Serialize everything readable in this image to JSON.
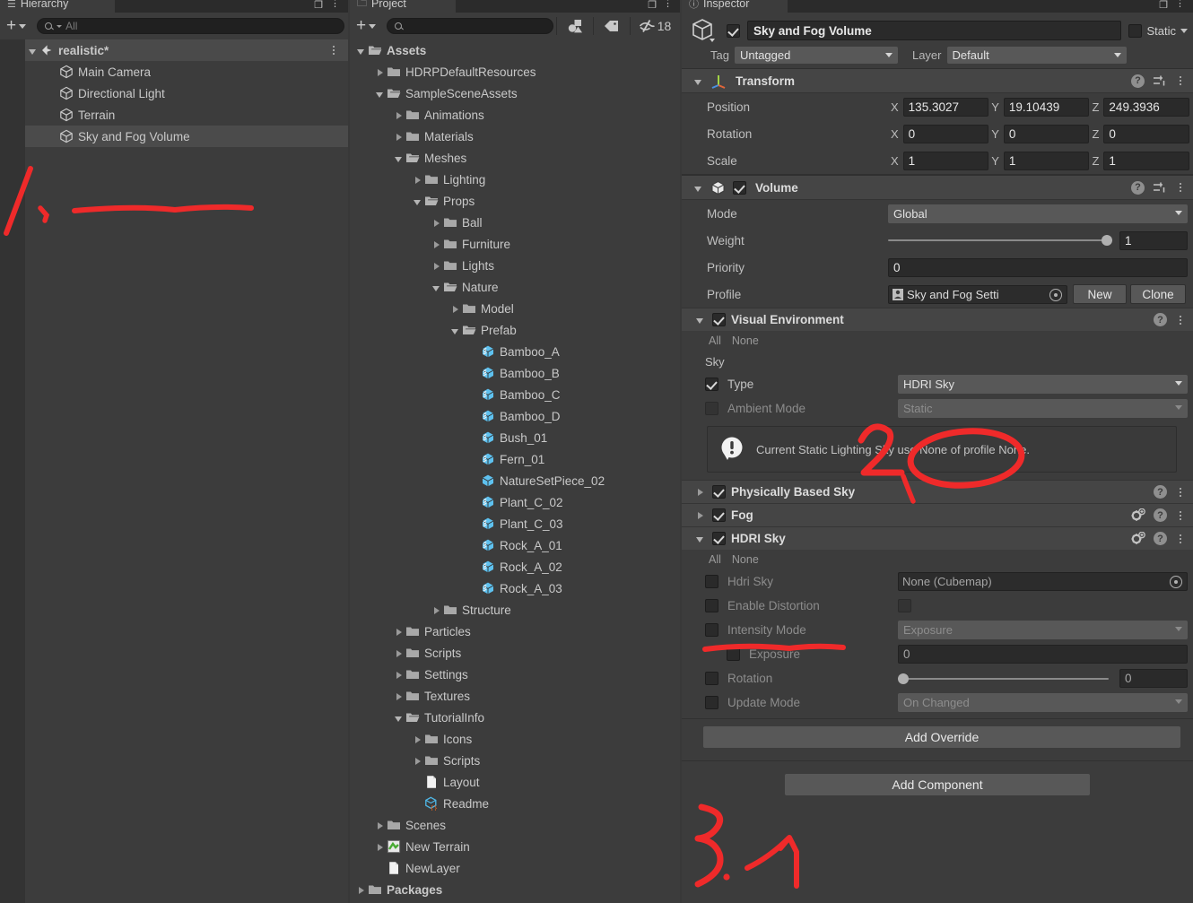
{
  "window": {
    "hierarchy_tab": "Hierarchy",
    "project_tab": "Project",
    "inspector_tab": "Inspector"
  },
  "hierarchy": {
    "search_placeholder": "All",
    "create_label": "+",
    "items": [
      {
        "label": "realistic*",
        "icon": "unity-scene-icon",
        "depth": 0,
        "expanded": true,
        "selected": false,
        "bold": true
      },
      {
        "label": "Main Camera",
        "icon": "gameobject-cube-icon",
        "depth": 1,
        "selected": false
      },
      {
        "label": "Directional Light",
        "icon": "gameobject-cube-icon",
        "depth": 1,
        "selected": false
      },
      {
        "label": "Terrain",
        "icon": "gameobject-cube-icon",
        "depth": 1,
        "selected": false
      },
      {
        "label": "Sky and Fog Volume",
        "icon": "gameobject-cube-icon",
        "depth": 1,
        "selected": true
      }
    ]
  },
  "project": {
    "search_placeholder": "",
    "create_label": "+",
    "hidden_count": "18",
    "items": [
      {
        "label": "Assets",
        "icon": "folder-open-icon",
        "depth": 0,
        "arrow": "down",
        "bold": true
      },
      {
        "label": "HDRPDefaultResources",
        "icon": "folder-icon",
        "depth": 1,
        "arrow": "right"
      },
      {
        "label": "SampleSceneAssets",
        "icon": "folder-open-icon",
        "depth": 1,
        "arrow": "down"
      },
      {
        "label": "Animations",
        "icon": "folder-icon",
        "depth": 2,
        "arrow": "right"
      },
      {
        "label": "Materials",
        "icon": "folder-icon",
        "depth": 2,
        "arrow": "right"
      },
      {
        "label": "Meshes",
        "icon": "folder-open-icon",
        "depth": 2,
        "arrow": "down"
      },
      {
        "label": "Lighting",
        "icon": "folder-icon",
        "depth": 3,
        "arrow": "right"
      },
      {
        "label": "Props",
        "icon": "folder-open-icon",
        "depth": 3,
        "arrow": "down"
      },
      {
        "label": "Ball",
        "icon": "folder-icon",
        "depth": 4,
        "arrow": "right"
      },
      {
        "label": "Furniture",
        "icon": "folder-icon",
        "depth": 4,
        "arrow": "right"
      },
      {
        "label": "Lights",
        "icon": "folder-icon",
        "depth": 4,
        "arrow": "right"
      },
      {
        "label": "Nature",
        "icon": "folder-open-icon",
        "depth": 4,
        "arrow": "down"
      },
      {
        "label": "Model",
        "icon": "folder-icon",
        "depth": 5,
        "arrow": "right"
      },
      {
        "label": "Prefab",
        "icon": "folder-open-icon",
        "depth": 5,
        "arrow": "down"
      },
      {
        "label": "Bamboo_A",
        "icon": "prefab-variant-icon",
        "depth": 6,
        "arrow": "none"
      },
      {
        "label": "Bamboo_B",
        "icon": "prefab-variant-icon",
        "depth": 6,
        "arrow": "none"
      },
      {
        "label": "Bamboo_C",
        "icon": "prefab-variant-icon",
        "depth": 6,
        "arrow": "none"
      },
      {
        "label": "Bamboo_D",
        "icon": "prefab-variant-icon",
        "depth": 6,
        "arrow": "none"
      },
      {
        "label": "Bush_01",
        "icon": "prefab-variant-icon",
        "depth": 6,
        "arrow": "none"
      },
      {
        "label": "Fern_01",
        "icon": "prefab-variant-icon",
        "depth": 6,
        "arrow": "none"
      },
      {
        "label": "NatureSetPiece_02",
        "icon": "prefab-icon",
        "depth": 6,
        "arrow": "none"
      },
      {
        "label": "Plant_C_02",
        "icon": "prefab-variant-icon",
        "depth": 6,
        "arrow": "none"
      },
      {
        "label": "Plant_C_03",
        "icon": "prefab-variant-icon",
        "depth": 6,
        "arrow": "none"
      },
      {
        "label": "Rock_A_01",
        "icon": "prefab-variant-icon",
        "depth": 6,
        "arrow": "none"
      },
      {
        "label": "Rock_A_02",
        "icon": "prefab-variant-icon",
        "depth": 6,
        "arrow": "none"
      },
      {
        "label": "Rock_A_03",
        "icon": "prefab-variant-icon",
        "depth": 6,
        "arrow": "none"
      },
      {
        "label": "Structure",
        "icon": "folder-icon",
        "depth": 4,
        "arrow": "right"
      },
      {
        "label": "Particles",
        "icon": "folder-icon",
        "depth": 2,
        "arrow": "right"
      },
      {
        "label": "Scripts",
        "icon": "folder-icon",
        "depth": 2,
        "arrow": "right"
      },
      {
        "label": "Settings",
        "icon": "folder-icon",
        "depth": 2,
        "arrow": "right"
      },
      {
        "label": "Textures",
        "icon": "folder-icon",
        "depth": 2,
        "arrow": "right"
      },
      {
        "label": "TutorialInfo",
        "icon": "folder-open-icon",
        "depth": 2,
        "arrow": "down"
      },
      {
        "label": "Icons",
        "icon": "folder-icon",
        "depth": 3,
        "arrow": "right"
      },
      {
        "label": "Scripts",
        "icon": "folder-icon",
        "depth": 3,
        "arrow": "right"
      },
      {
        "label": "Layout",
        "icon": "document-icon",
        "depth": 3,
        "arrow": "none"
      },
      {
        "label": "Readme",
        "icon": "script-asset-icon",
        "depth": 3,
        "arrow": "none"
      },
      {
        "label": "Scenes",
        "icon": "folder-icon",
        "depth": 1,
        "arrow": "right"
      },
      {
        "label": "New Terrain",
        "icon": "terrain-asset-icon",
        "depth": 1,
        "arrow": "right"
      },
      {
        "label": "NewLayer",
        "icon": "document-icon",
        "depth": 1,
        "arrow": "none"
      },
      {
        "label": "Packages",
        "icon": "folder-icon",
        "depth": 0,
        "arrow": "right",
        "bold": true
      }
    ]
  },
  "inspector": {
    "object": {
      "name": "Sky and Fog Volume",
      "enabled": true,
      "static_label": "Static",
      "tag_label": "Tag",
      "tag_value": "Untagged",
      "layer_label": "Layer",
      "layer_value": "Default"
    },
    "transform": {
      "title": "Transform",
      "rows": [
        {
          "label": "Position",
          "x": "135.3027",
          "y": "19.10439",
          "z": "249.3936"
        },
        {
          "label": "Rotation",
          "x": "0",
          "y": "0",
          "z": "0"
        },
        {
          "label": "Scale",
          "x": "1",
          "y": "1",
          "z": "1"
        }
      ],
      "axis_x": "X",
      "axis_y": "Y",
      "axis_z": "Z"
    },
    "volume": {
      "title": "Volume",
      "enabled": true,
      "mode_label": "Mode",
      "mode_value": "Global",
      "weight_label": "Weight",
      "weight_value": "1",
      "weight_percent": 100,
      "priority_label": "Priority",
      "priority_value": "0",
      "profile_label": "Profile",
      "profile_value": "Sky and Fog Setti",
      "new_label": "New",
      "clone_label": "Clone"
    },
    "visual_environment": {
      "title": "Visual Environment",
      "enabled": true,
      "expanded": true,
      "all_label": "All",
      "none_label": "None",
      "group_label": "Sky",
      "rows": [
        {
          "label": "Type",
          "value": "HDRI Sky",
          "checked": true,
          "disabled": false
        },
        {
          "label": "Ambient Mode",
          "value": "Static",
          "checked": false,
          "disabled": true
        }
      ],
      "info_message": "Current Static Lighting Sky use None of profile None."
    },
    "overrides": [
      {
        "title": "Physically Based Sky",
        "enabled": true,
        "expanded": false,
        "has_gear": false
      },
      {
        "title": "Fog",
        "enabled": true,
        "expanded": false,
        "has_gear": true
      }
    ],
    "hdri_sky": {
      "title": "HDRI Sky",
      "enabled": true,
      "expanded": true,
      "has_gear": true,
      "all_label": "All",
      "none_label": "None",
      "rows": [
        {
          "label": "Hdri Sky",
          "value": "None (Cubemap)",
          "kind": "object",
          "checked": false
        },
        {
          "label": "Enable Distortion",
          "value": "",
          "kind": "checkbox",
          "checked": false
        },
        {
          "label": "Intensity Mode",
          "value": "Exposure",
          "kind": "dropdown",
          "checked": false
        },
        {
          "label": "Exposure",
          "value": "0",
          "kind": "number",
          "checked": false,
          "indent": true
        },
        {
          "label": "Rotation",
          "value": "0",
          "kind": "slider",
          "checked": false,
          "percent": 0
        },
        {
          "label": "Update Mode",
          "value": "On Changed",
          "kind": "dropdown",
          "checked": false
        }
      ]
    },
    "add_override_label": "Add Override",
    "add_component_label": "Add Component"
  },
  "annotations": {
    "marker_1": "1",
    "marker_2": "2",
    "marker_3": "3",
    "color": "#ef2a2a"
  }
}
